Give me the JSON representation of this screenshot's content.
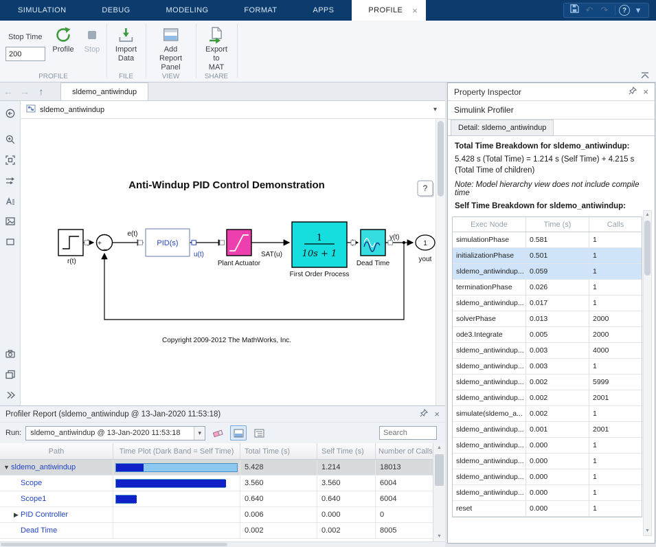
{
  "icons": {
    "close": "×",
    "caret_down": "▾",
    "help": "?",
    "undo": "↶",
    "redo": "↷",
    "nav_back": "←",
    "nav_forward": "→",
    "nav_up": "↑",
    "scroll_up": "▲",
    "scroll_down": "▼"
  },
  "menubar": {
    "tabs": [
      "SIMULATION",
      "DEBUG",
      "MODELING",
      "FORMAT",
      "APPS"
    ],
    "active_tab": "PROFILE"
  },
  "ribbon": {
    "stop_time_label": "Stop Time",
    "stop_time_value": "200",
    "buttons": {
      "profile": "Profile",
      "stop": "Stop",
      "import1": "Import",
      "import2": "Data",
      "report1": "Add Report",
      "report2": "Panel",
      "export1": "Export",
      "export2": "to MAT"
    },
    "sections": {
      "profile": "PROFILE",
      "file": "FILE",
      "view": "VIEW",
      "share": "SHARE"
    }
  },
  "editor": {
    "doc_tab": "sldemo_antiwindup",
    "breadcrumb": "sldemo_antiwindup"
  },
  "diagram": {
    "title": "Anti-Windup PID Control Demonstration",
    "help": "?",
    "step_label": "r(t)",
    "sum_plus": "+",
    "sum_minus": "−",
    "e_label": "e(t)",
    "pid_label": "PID(s)",
    "u_label": "u(t)",
    "actuator_label": "Plant Actuator",
    "sat_label": "SAT(u)",
    "tf_num": "1",
    "tf_den": "10s + 1",
    "process_label": "First Order Process",
    "delay_label": "Dead Time",
    "y_label": "y(t)",
    "out_port": "1",
    "out_label": "yout",
    "copyright": "Copyright 2009-2012 The MathWorks, Inc."
  },
  "report": {
    "title": "Profiler Report (sldemo_antiwindup @ 13-Jan-2020 11:53:18)",
    "run_label": "Run:",
    "run_value": "sldemo_antiwindup @ 13-Jan-2020 11:53:18",
    "search_placeholder": "Search",
    "columns": [
      "Path",
      "Time Plot (Dark Band = Self Time)",
      "Total Time (s)",
      "Self Time (s)",
      "Number of Calls"
    ],
    "rows": [
      {
        "expander": "▼",
        "path": "sldemo_antiwindup",
        "total": "5.428",
        "self": "1.214",
        "calls": "18013",
        "bar_total": 178,
        "bar_self": 40,
        "row_class": "selected",
        "pad_class": "pad0"
      },
      {
        "expander": "",
        "path": "Scope",
        "total": "3.560",
        "self": "3.560",
        "calls": "6004",
        "bar_total": 160,
        "bar_self": 160,
        "row_class": "",
        "pad_class": "pad1"
      },
      {
        "expander": "",
        "path": "Scope1",
        "total": "0.640",
        "self": "0.640",
        "calls": "6004",
        "bar_total": 30,
        "bar_self": 30,
        "row_class": "",
        "pad_class": "pad1"
      },
      {
        "expander": "▶",
        "path": "PID Controller",
        "total": "0.006",
        "self": "0.000",
        "calls": "0",
        "bar_total": 0,
        "bar_self": 0,
        "row_class": "",
        "pad_class": "pad1"
      },
      {
        "expander": "",
        "path": "Dead Time",
        "total": "0.002",
        "self": "0.002",
        "calls": "8005",
        "bar_total": 0,
        "bar_self": 0,
        "row_class": "",
        "pad_class": "pad1"
      }
    ]
  },
  "inspector": {
    "title": "Property Inspector",
    "subtitle": "Simulink Profiler",
    "tab": "Detail: sldemo_antiwindup",
    "heading_total": "Total Time Breakdown for sldemo_antiwindup:",
    "text_total": "5.428 s (Total Time) = 1.214 s (Self Time) + 4.215 s (Total Time of children)",
    "note": "Note: Model hierarchy view does not include compile time",
    "heading_self": "Self Time Breakdown for sldemo_antiwindup:",
    "columns": [
      "Exec Node",
      "Time (s)",
      "Calls"
    ],
    "rows": [
      {
        "node": "simulationPhase",
        "time": "0.581",
        "calls": "1",
        "row_class": ""
      },
      {
        "node": "initializationPhase",
        "time": "0.501",
        "calls": "1",
        "row_class": "hl"
      },
      {
        "node": "sldemo_antiwindup...",
        "time": "0.059",
        "calls": "1",
        "row_class": "hl"
      },
      {
        "node": "terminationPhase",
        "time": "0.026",
        "calls": "1",
        "row_class": ""
      },
      {
        "node": "sldemo_antiwindup...",
        "time": "0.017",
        "calls": "1",
        "row_class": ""
      },
      {
        "node": "solverPhase",
        "time": "0.013",
        "calls": "2000",
        "row_class": ""
      },
      {
        "node": "ode3.Integrate",
        "time": "0.005",
        "calls": "2000",
        "row_class": ""
      },
      {
        "node": "sldemo_antiwindup...",
        "time": "0.003",
        "calls": "4000",
        "row_class": ""
      },
      {
        "node": "sldemo_antiwindup...",
        "time": "0.003",
        "calls": "1",
        "row_class": ""
      },
      {
        "node": "sldemo_antiwindup...",
        "time": "0.002",
        "calls": "5999",
        "row_class": ""
      },
      {
        "node": "sldemo_antiwindup...",
        "time": "0.002",
        "calls": "2001",
        "row_class": ""
      },
      {
        "node": "simulate(sldemo_a...",
        "time": "0.002",
        "calls": "1",
        "row_class": ""
      },
      {
        "node": "sldemo_antiwindup...",
        "time": "0.001",
        "calls": "2001",
        "row_class": ""
      },
      {
        "node": "sldemo_antiwindup...",
        "time": "0.000",
        "calls": "1",
        "row_class": ""
      },
      {
        "node": "sldemo_antiwindup...",
        "time": "0.000",
        "calls": "1",
        "row_class": ""
      },
      {
        "node": "sldemo_antiwindup...",
        "time": "0.000",
        "calls": "1",
        "row_class": ""
      },
      {
        "node": "sldemo_antiwindup...",
        "time": "0.000",
        "calls": "1",
        "row_class": ""
      },
      {
        "node": "reset",
        "time": "0.000",
        "calls": "1",
        "row_class": ""
      }
    ]
  },
  "chart_data": {
    "type": "table",
    "title": "Time Plot (Dark Band = Self Time)",
    "rows": [
      {
        "path": "sldemo_antiwindup",
        "total_time_s": 5.428,
        "self_time_s": 1.214,
        "calls": 18013
      },
      {
        "path": "Scope",
        "total_time_s": 3.56,
        "self_time_s": 3.56,
        "calls": 6004
      },
      {
        "path": "Scope1",
        "total_time_s": 0.64,
        "self_time_s": 0.64,
        "calls": 6004
      },
      {
        "path": "PID Controller",
        "total_time_s": 0.006,
        "self_time_s": 0.0,
        "calls": 0
      },
      {
        "path": "Dead Time",
        "total_time_s": 0.002,
        "self_time_s": 0.002,
        "calls": 8005
      }
    ]
  }
}
